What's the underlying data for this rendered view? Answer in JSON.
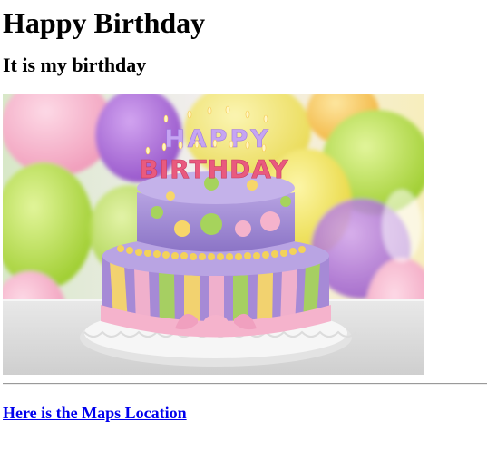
{
  "page": {
    "title": "Happy Birthday",
    "subtitle": "It is my birthday",
    "image_alt": "Birthday cake with candles spelling Happy Birthday",
    "cake_topper": {
      "line1": "HAPPY",
      "line2": "BIRTHDAY"
    },
    "maps_link_label": "Here is the Maps Location"
  },
  "colors": {
    "link": "#0000ee",
    "cake_top": "#9c88d0",
    "cake_bottom": "#a68ad6",
    "frosting_pink": "#f5b3cc",
    "plate": "#f2f2f2"
  }
}
